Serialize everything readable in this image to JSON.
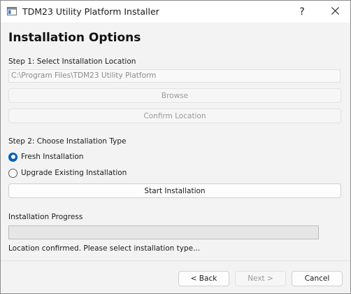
{
  "window": {
    "title": "TDM23 Utility Platform Installer",
    "help_glyph": "?",
    "close_glyph": "✕",
    "icon": "installer-app-icon"
  },
  "page": {
    "title": "Installation Options"
  },
  "step1": {
    "label": "Step 1: Select Installation Location",
    "path_value": "C:\\Program Files\\TDM23 Utility Platform",
    "browse_label": "Browse",
    "confirm_label": "Confirm Location"
  },
  "step2": {
    "label": "Step 2: Choose Installation Type",
    "options": [
      {
        "label": "Fresh Installation",
        "selected": true
      },
      {
        "label": "Upgrade Existing Installation",
        "selected": false
      }
    ],
    "start_label": "Start Installation"
  },
  "progress": {
    "label": "Installation Progress",
    "value": 0,
    "status": "Location confirmed. Please select installation type..."
  },
  "footer": {
    "back_label": "< Back",
    "next_label": "Next >",
    "cancel_label": "Cancel"
  },
  "colors": {
    "accent": "#005fb8",
    "progress_fill": "#06b025",
    "disabled_text": "#9a9a9a"
  }
}
